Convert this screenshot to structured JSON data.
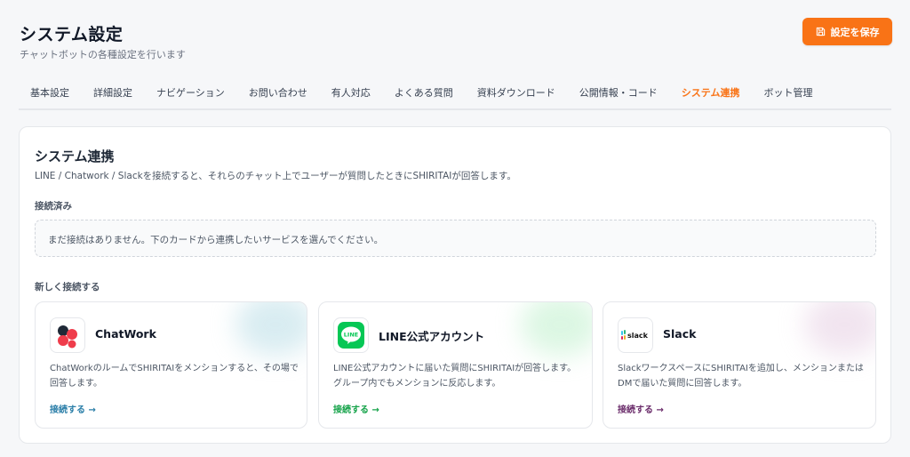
{
  "header": {
    "title": "システム設定",
    "subtitle": "チャットボットの各種設定を行います",
    "save_label": "設定を保存"
  },
  "tabs": [
    {
      "label": "基本設定"
    },
    {
      "label": "詳細設定"
    },
    {
      "label": "ナビゲーション"
    },
    {
      "label": "お問い合わせ"
    },
    {
      "label": "有人対応"
    },
    {
      "label": "よくある質問"
    },
    {
      "label": "資料ダウンロード"
    },
    {
      "label": "公開情報・コード"
    },
    {
      "label": "システム連携",
      "active": true
    },
    {
      "label": "ボット管理"
    }
  ],
  "section": {
    "title": "システム連携",
    "description": "LINE / Chatwork / Slackを接続すると、それらのチャット上でユーザーが質問したときにSHIRITAIが回答します。",
    "connected_label": "接続済み",
    "empty_message": "まだ接続はありません。下のカードから連携したいサービスを選んでください。",
    "new_label": "新しく接続する"
  },
  "services": [
    {
      "name": "ChatWork",
      "description": "ChatWorkのルームでSHIRITAIをメンションすると、その場で回答します。",
      "link_label": "接続する →",
      "link_color": "#2a7ea8",
      "glow_color": "#b9dde6",
      "icon": "chatwork-logo-icon"
    },
    {
      "name": "LINE公式アカウント",
      "description": "LINE公式アカウントに届いた質問にSHIRITAIが回答します。グループ内でもメンションに反応します。",
      "link_label": "接続する →",
      "link_color": "#16a34a",
      "glow_color": "#bff0cc",
      "icon": "line-logo-icon",
      "logo_text": "LINE"
    },
    {
      "name": "Slack",
      "description": "SlackワークスペースにSHIRITAIを追加し、メンションまたはDMで届いた質問に回答します。",
      "link_label": "接続する →",
      "link_color": "#6b2d6b",
      "glow_color": "#e6cfe3",
      "icon": "slack-logo-icon",
      "logo_text": "slack"
    }
  ],
  "colors": {
    "accent": "#f97316"
  }
}
